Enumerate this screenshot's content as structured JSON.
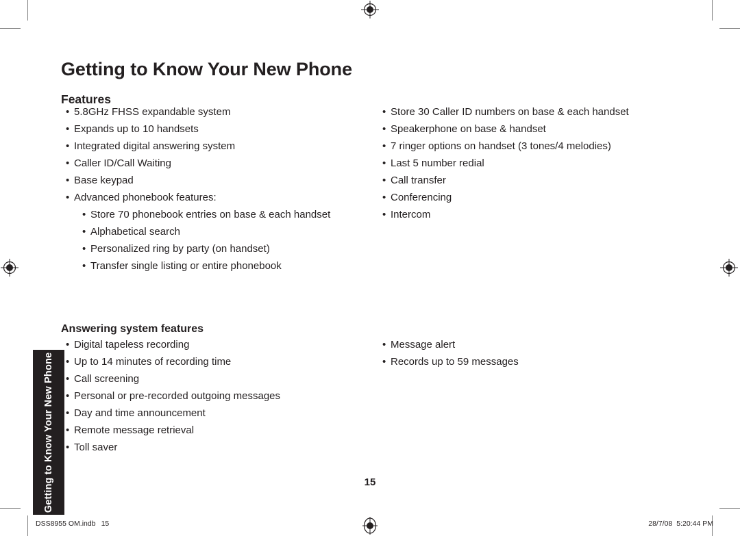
{
  "document": {
    "page_title": "Getting to Know Your New Phone",
    "page_number": "15",
    "side_tab_label": "Getting to Know Your New Phone"
  },
  "features": {
    "heading": "Features",
    "left_items": [
      {
        "text": "5.8GHz FHSS expandable system",
        "level": 1
      },
      {
        "text": "Expands up to 10 handsets",
        "level": 1
      },
      {
        "text": "Integrated digital answering system",
        "level": 1
      },
      {
        "text": "Caller ID/Call Waiting",
        "level": 1
      },
      {
        "text": "Base keypad",
        "level": 1
      },
      {
        "text": "Advanced phonebook features:",
        "level": 1
      },
      {
        "text": "Store 70 phonebook entries on base & each handset",
        "level": 2
      },
      {
        "text": "Alphabetical search",
        "level": 2
      },
      {
        "text": "Personalized ring by party (on handset)",
        "level": 2
      },
      {
        "text": "Transfer single listing or entire phonebook",
        "level": 2
      }
    ],
    "right_items": [
      {
        "text": "Store 30 Caller ID numbers on base & each handset",
        "level": 1
      },
      {
        "text": "Speakerphone on base & handset",
        "level": 1
      },
      {
        "text": "7 ringer options on handset (3 tones/4 melodies)",
        "level": 1
      },
      {
        "text": "Last 5 number redial",
        "level": 1
      },
      {
        "text": "Call transfer",
        "level": 1
      },
      {
        "text": "Conferencing",
        "level": 1
      },
      {
        "text": "Intercom",
        "level": 1
      }
    ]
  },
  "answering_system": {
    "heading": "Answering system features",
    "left_items": [
      {
        "text": "Digital tapeless recording",
        "level": 1
      },
      {
        "text": "Up to 14 minutes of recording time",
        "level": 1
      },
      {
        "text": "Call screening",
        "level": 1
      },
      {
        "text": "Personal or pre-recorded outgoing messages",
        "level": 1
      },
      {
        "text": "Day and time announcement",
        "level": 1
      },
      {
        "text": "Remote message retrieval",
        "level": 1
      },
      {
        "text": "Toll saver",
        "level": 1
      }
    ],
    "right_items": [
      {
        "text": "Message alert",
        "level": 1
      },
      {
        "text": "Records up to 59 messages",
        "level": 1
      }
    ]
  },
  "footer": {
    "file_name": "DSS8955 OM.indb",
    "file_page": "15",
    "date": "28/7/08",
    "time": "5:20:44 PM"
  },
  "symbols": {
    "bullet": "•"
  },
  "colors": {
    "text": "#231f20",
    "tab_background": "#231f20",
    "tab_text": "#ffffff",
    "crop_mark": "#808080",
    "page_background": "#ffffff"
  }
}
